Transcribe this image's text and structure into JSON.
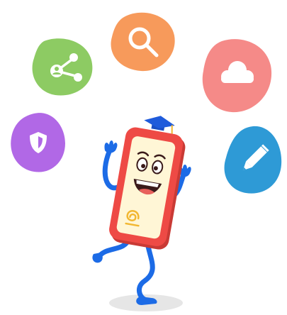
{
  "colors": {
    "search_blob": "#F79A5B",
    "share_blob": "#8DCB63",
    "cloud_blob": "#F58A88",
    "shield_blob": "#B168E6",
    "pencil_blob": "#2E9AD6",
    "phone_body": "#EE4A45",
    "phone_screen": "#FFF6D6",
    "mortarboard": "#1F5BDB",
    "limbs": "#1C6BE6",
    "shadow": "#E6E6E6"
  },
  "icons": {
    "search": "magnifier-icon",
    "share": "share-network-icon",
    "cloud": "cloud-icon",
    "shield": "shield-icon",
    "pencil": "pencil-icon"
  }
}
